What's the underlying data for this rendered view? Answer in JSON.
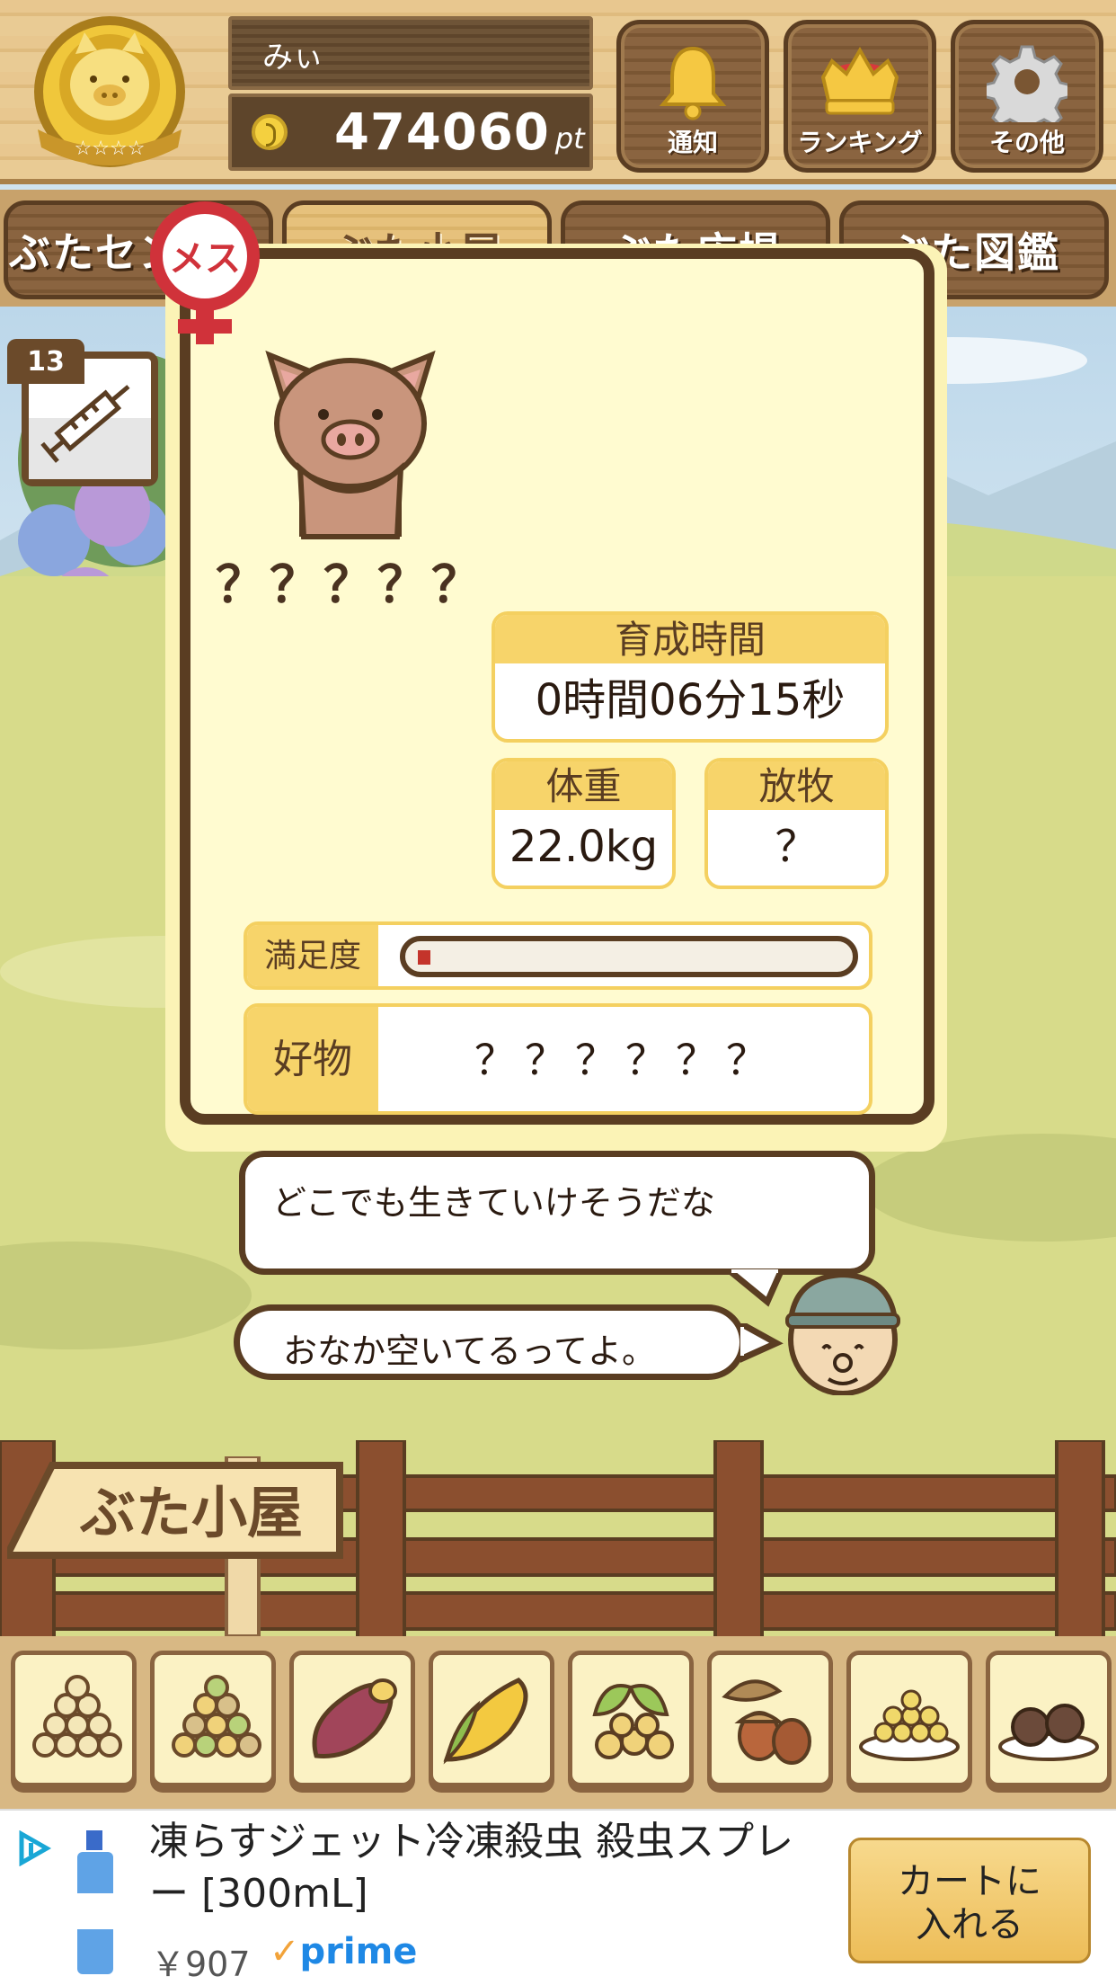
{
  "header": {
    "user_name": "みぃ",
    "points_value": "474060",
    "points_unit": "pt",
    "buttons": [
      {
        "label": "通知",
        "icon": "bell-icon"
      },
      {
        "label": "ランキング",
        "icon": "crown-icon"
      },
      {
        "label": "その他",
        "icon": "gear-icon"
      }
    ]
  },
  "nav": {
    "tabs": [
      {
        "label": "ぶたセンター",
        "active": false
      },
      {
        "label": "ぶた小屋",
        "active": true
      },
      {
        "label": "ぶた広場",
        "active": false
      },
      {
        "label": "ぶた図鑑",
        "active": false
      }
    ]
  },
  "syringe": {
    "count": "13",
    "icon": "syringe-icon"
  },
  "pig": {
    "gender_label": "メス",
    "name": "？？？？？",
    "raising_time_label": "育成時間",
    "raising_time_value": "0時間06分15秒",
    "weight_label": "体重",
    "weight_value": "22.0kg",
    "grazing_label": "放牧",
    "grazing_value": "？",
    "satisfaction_label": "満足度",
    "satisfaction_level": 0.03,
    "favorite_label": "好物",
    "favorite_value": "？？？？？？"
  },
  "dialog": {
    "line1": "どこでも生きていけそうだな",
    "line2": "おなか空いてるってよ。"
  },
  "sign": {
    "label": "ぶた小屋"
  },
  "food_items": [
    "grain-small-icon",
    "grain-mixed-icon",
    "sweet-potato-icon",
    "corn-icon",
    "beans-leaf-icon",
    "acorn-icon",
    "soybean-plate-icon",
    "dumpling-plate-icon"
  ],
  "ad": {
    "title": "凍らすジェット冷凍殺虫 殺虫スプレー [300mL]",
    "price": "￥907",
    "prime_label": "prime",
    "button_label": "カートに入れる"
  },
  "colors": {
    "wood_dark": "#5a3d22",
    "card_bg": "#fffbd0",
    "label_yellow": "#f7d46a",
    "gender_red": "#d0323a",
    "bar_fill": "#c4342b"
  }
}
